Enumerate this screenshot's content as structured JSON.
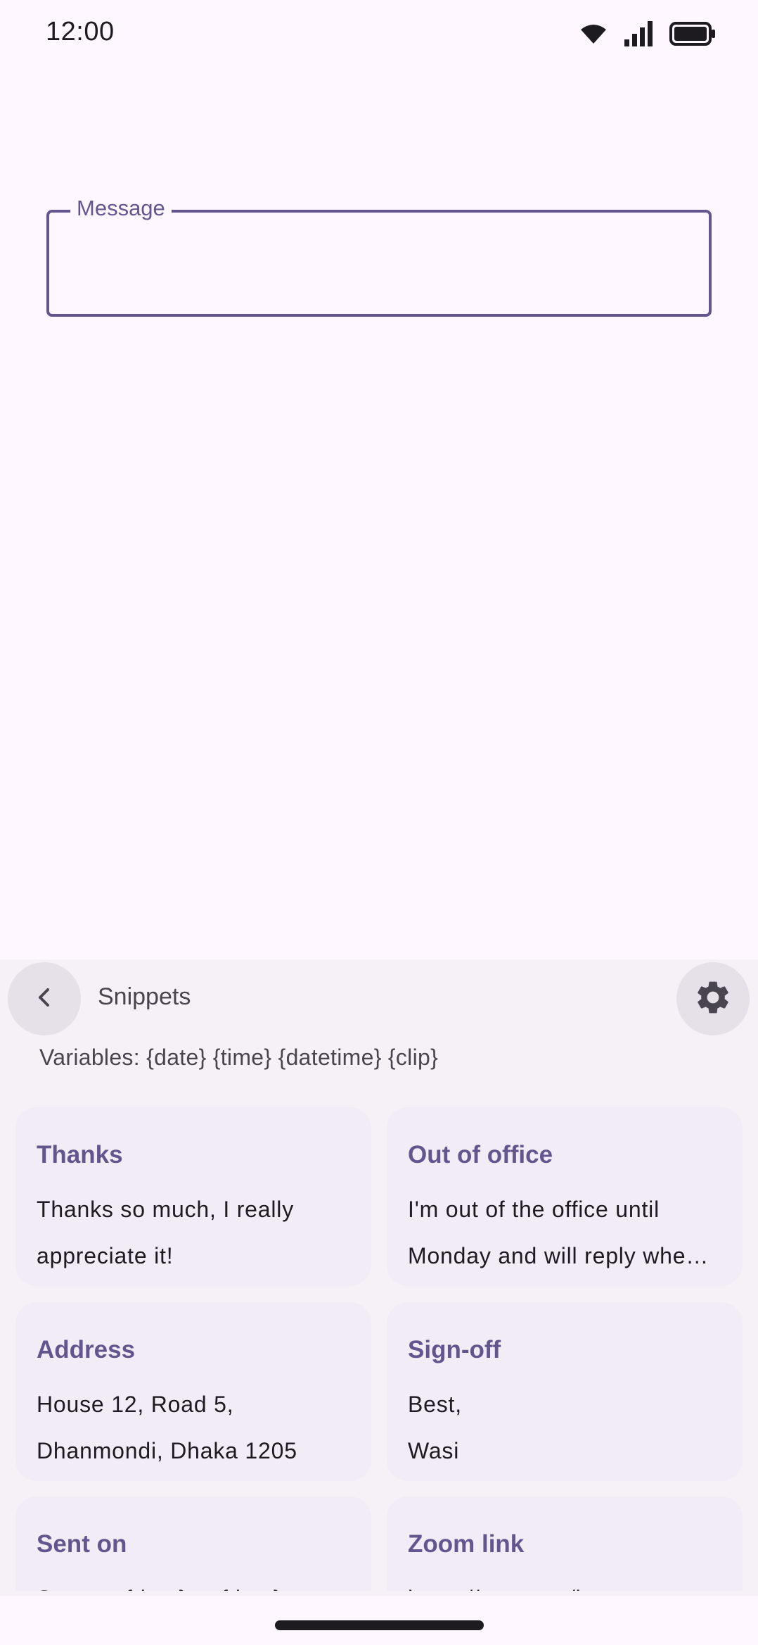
{
  "status_bar": {
    "time": "12:00",
    "icons": [
      "wifi-icon",
      "signal-icon",
      "battery-icon"
    ]
  },
  "message_field": {
    "label": "Message",
    "value": ""
  },
  "snippets_panel": {
    "title": "Snippets",
    "back_icon": "chevron-left-icon",
    "settings_icon": "gear-icon",
    "variables_text": "Variables: {date} {time} {datetime} {clip}",
    "cards": [
      {
        "title": "Thanks",
        "line1": "Thanks so much, I really",
        "line2": "appreciate it!"
      },
      {
        "title": "Out of office",
        "line1": "I'm out of the office until",
        "line2": "Monday and will reply whe…"
      },
      {
        "title": "Address",
        "line1": "House 12, Road 5,",
        "line2": "Dhanmondi, Dhaka 1205"
      },
      {
        "title": "Sign-off",
        "line1": "Best,",
        "line2": "Wasi"
      },
      {
        "title": "Sent on",
        "line1": "Sent on {date} at {time}",
        "line2": ""
      },
      {
        "title": "Zoom link",
        "line1": "https://zoom.us/j",
        "line2": ""
      }
    ]
  },
  "colors": {
    "accent": "#65558F",
    "background": "#FEF7FF",
    "panel": "#F6F1F7",
    "card": "#F2ECF6"
  }
}
